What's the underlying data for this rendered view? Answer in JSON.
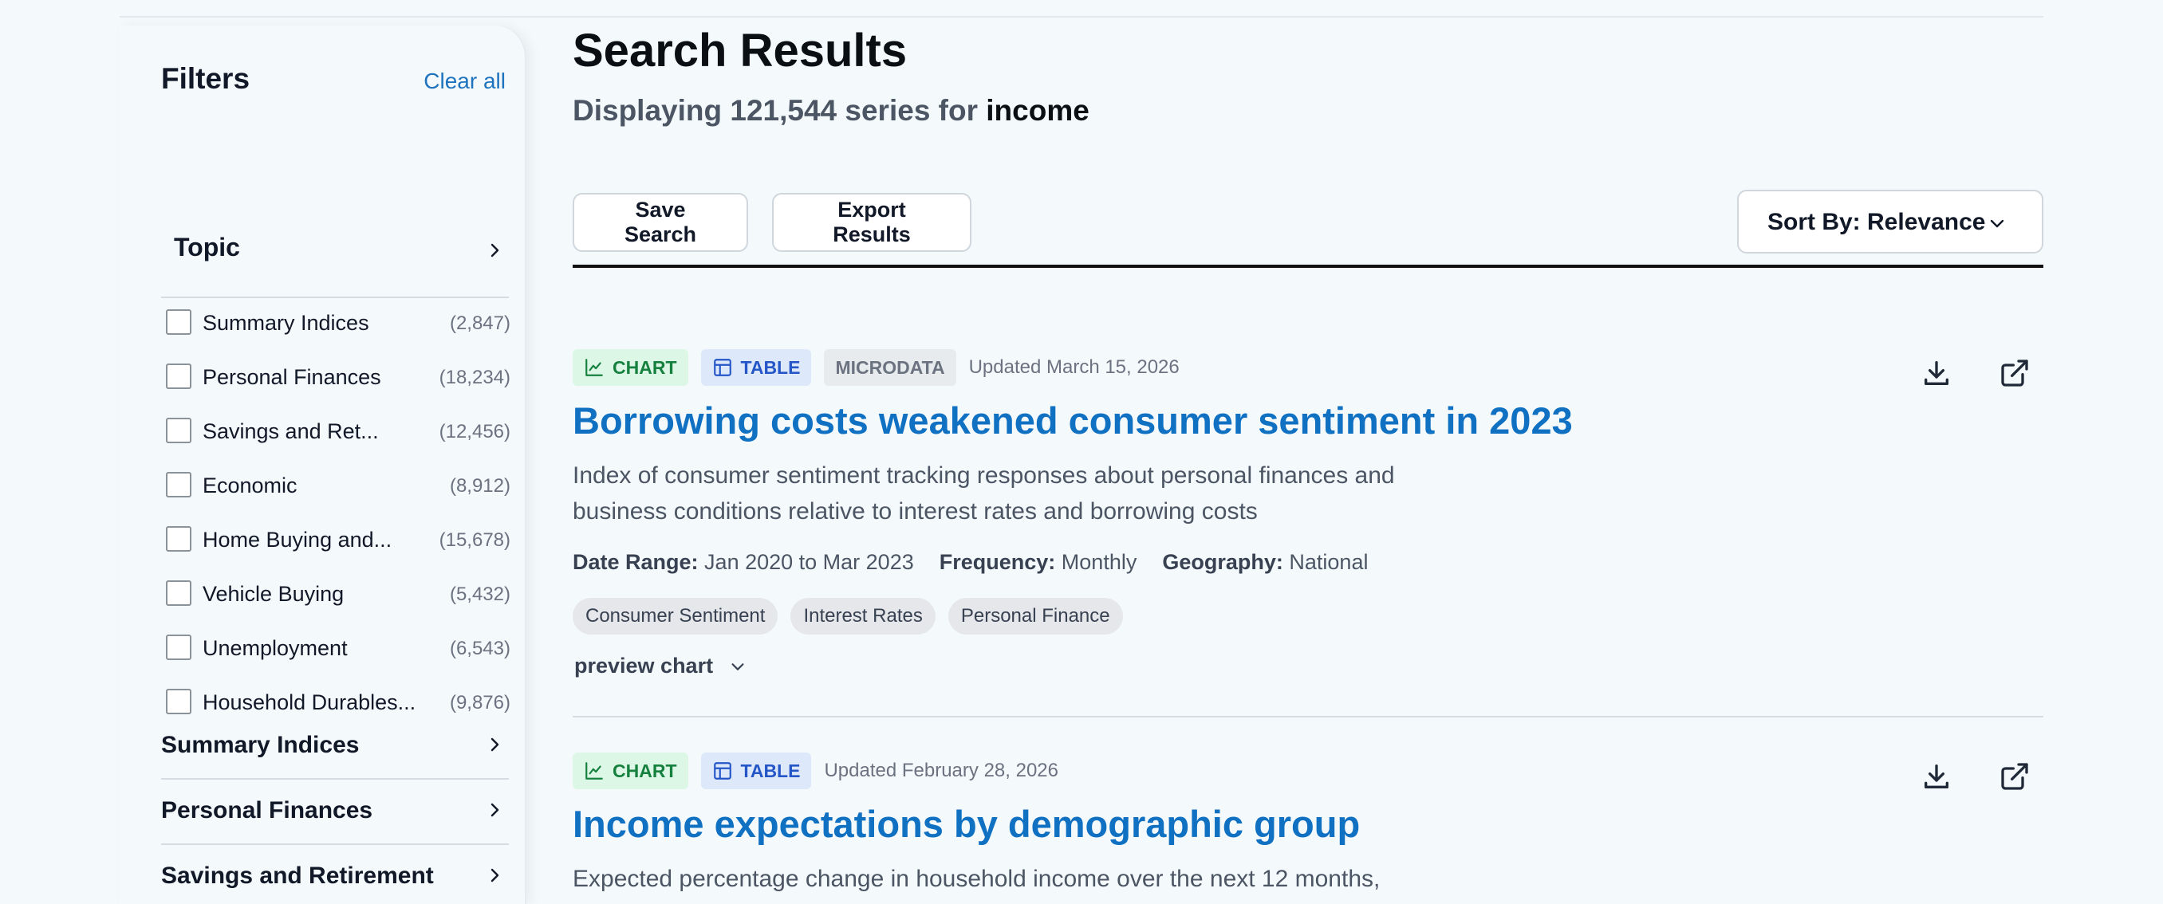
{
  "filters": {
    "title": "Filters",
    "clear_all": "Clear all",
    "topic": {
      "label": "Topic",
      "items": [
        {
          "name": "Summary Indices",
          "count": "(2,847)"
        },
        {
          "name": "Personal Finances",
          "count": "(18,234)"
        },
        {
          "name": "Savings and Ret...",
          "count": "(12,456)"
        },
        {
          "name": "Economic",
          "count": "(8,912)"
        },
        {
          "name": "Home Buying and...",
          "count": "(15,678)"
        },
        {
          "name": "Vehicle Buying",
          "count": "(5,432)"
        },
        {
          "name": "Unemployment",
          "count": "(6,543)"
        },
        {
          "name": "Household Durables...",
          "count": "(9,876)"
        }
      ]
    },
    "categories": [
      "Summary Indices",
      "Personal Finances",
      "Savings and Retirement"
    ]
  },
  "header": {
    "title": "Search Results",
    "subtitle_prefix": "Displaying 121,544 series for",
    "search_term": "income"
  },
  "toolbar": {
    "save_label": "Save Search",
    "export_label": "Export Results",
    "sort_label": "Sort By: Relevance"
  },
  "results": [
    {
      "badges": {
        "chart": "CHART",
        "table": "TABLE",
        "micro": "MICRODATA"
      },
      "updated": "Updated March 15, 2026",
      "title": "Borrowing costs weakened consumer sentiment in 2023",
      "description": "Index of consumer sentiment tracking responses about personal finances and business conditions relative to interest rates and borrowing costs",
      "meta": {
        "date_label": "Date Range:",
        "date_value": "Jan 2020 to Mar 2023",
        "freq_label": "Frequency:",
        "freq_value": "Monthly",
        "geo_label": "Geography:",
        "geo_value": "National"
      },
      "tags": [
        "Consumer Sentiment",
        "Interest Rates",
        "Personal Finance"
      ],
      "preview": "preview chart"
    },
    {
      "badges": {
        "chart": "CHART",
        "table": "TABLE"
      },
      "updated": "Updated February 28, 2026",
      "title": "Income expectations by demographic group",
      "description": "Expected percentage change in household income over the next 12 months,"
    }
  ],
  "icons": {
    "chart": "line-chart-icon",
    "table": "table-icon",
    "download": "download-icon",
    "external": "external-link-icon",
    "chevron_right": "chevron-right-icon",
    "chevron_down": "chevron-down-icon"
  },
  "colors": {
    "accent": "#1070c2",
    "chart_badge_bg": "#dcf7e6",
    "chart_badge_fg": "#16813f",
    "table_badge_bg": "#dde8fb",
    "table_badge_fg": "#2456c8"
  }
}
